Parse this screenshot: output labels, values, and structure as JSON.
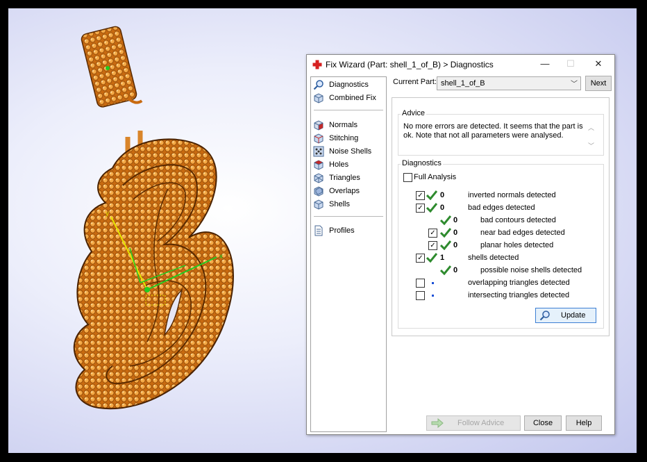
{
  "window": {
    "title": "Fix Wizard (Part: shell_1_of_B) > Diagnostics",
    "minimize": "—",
    "maximize": "☐",
    "close": "✕"
  },
  "nav": {
    "top": [
      {
        "label": "Diagnostics",
        "icon": "magnifier-icon"
      },
      {
        "label": "Combined Fix",
        "icon": "cube-icon"
      }
    ],
    "fixes": [
      {
        "label": "Normals",
        "icon": "normals-cube-icon"
      },
      {
        "label": "Stitching",
        "icon": "stitching-cube-icon"
      },
      {
        "label": "Noise Shells",
        "icon": "noise-shells-icon"
      },
      {
        "label": "Holes",
        "icon": "holes-cube-icon"
      },
      {
        "label": "Triangles",
        "icon": "triangles-cube-icon"
      },
      {
        "label": "Overlaps",
        "icon": "overlaps-cube-icon"
      },
      {
        "label": "Shells",
        "icon": "shells-cube-icon"
      }
    ],
    "bottom": [
      {
        "label": "Profiles",
        "icon": "document-icon"
      }
    ]
  },
  "current_part": {
    "label": "Current Part:",
    "value": "shell_1_of_B",
    "next": "Next"
  },
  "advice": {
    "title": "Advice",
    "text": "No more errors are detected. It seems that the part is ok. Note that not all parameters were analysed."
  },
  "diagnostics": {
    "title": "Diagnostics",
    "full_analysis": "Full Analysis",
    "rows": [
      {
        "checked": true,
        "status": "check",
        "count": "0",
        "label": "inverted normals detected"
      },
      {
        "checked": true,
        "status": "check",
        "count": "0",
        "label": "bad edges detected"
      },
      {
        "checked": false,
        "status": "check",
        "count": "0",
        "label": "bad contours detected"
      },
      {
        "checked": true,
        "status": "check",
        "count": "0",
        "label": "near bad edges detected"
      },
      {
        "checked": true,
        "status": "check",
        "count": "0",
        "label": "planar holes detected"
      },
      {
        "checked": true,
        "status": "check",
        "count": "1",
        "label": "shells detected"
      },
      {
        "checked": false,
        "status": "check",
        "count": "0",
        "label": "possible noise shells detected"
      },
      {
        "checked": false,
        "status": "dot",
        "count": "",
        "label": "overlapping triangles detected"
      },
      {
        "checked": false,
        "status": "dot",
        "count": "",
        "label": "intersecting triangles detected"
      }
    ],
    "update": "Update"
  },
  "footer": {
    "follow_advice": "Follow Advice",
    "close": "Close",
    "help": "Help"
  },
  "viewport": {
    "axis_x": "x",
    "axis_y": "y"
  },
  "colors": {
    "viewport_bg": "#d8dbf4",
    "model_orange": "#e88a1e",
    "check_green": "#2e8b2e",
    "title_icon_red": "#d62020",
    "axis_green": "#22cc22",
    "axis_yellow": "#e6e600"
  }
}
